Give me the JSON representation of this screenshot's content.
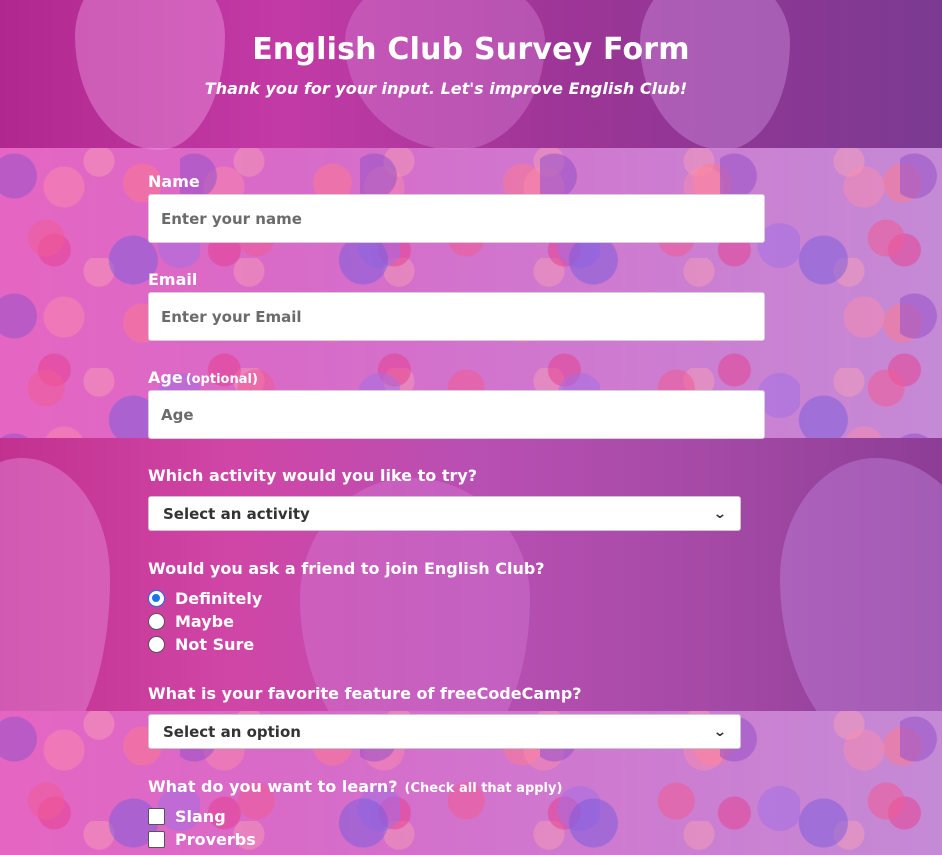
{
  "header": {
    "title": "English Club Survey Form",
    "subtitle": "Thank you for your input. Let's improve English Club!"
  },
  "fields": {
    "name": {
      "label": "Name",
      "placeholder": "Enter your name"
    },
    "email": {
      "label": "Email",
      "placeholder": "Enter your Email"
    },
    "age": {
      "label": "Age",
      "label_note": "(optional)",
      "placeholder": "Age"
    }
  },
  "activity": {
    "label": "Which activity would you like to try?",
    "selected": "Select an activity"
  },
  "recommend": {
    "label": "Would you ask a friend to join English Club?",
    "options": [
      {
        "label": "Definitely",
        "checked": true
      },
      {
        "label": "Maybe",
        "checked": false
      },
      {
        "label": "Not Sure",
        "checked": false
      }
    ]
  },
  "feature": {
    "label": "What is your favorite feature of freeCodeCamp?",
    "selected": "Select an option"
  },
  "learn": {
    "label": "What do you want to learn?",
    "label_note": "(Check all that apply)",
    "options": [
      {
        "label": "Slang",
        "checked": false
      },
      {
        "label": "Proverbs",
        "checked": false
      }
    ]
  },
  "icons": {
    "select_arrow": "chevron-down-icon"
  },
  "colors": {
    "radio_checked": "#1a73e8",
    "label_text": "#ffffff"
  }
}
